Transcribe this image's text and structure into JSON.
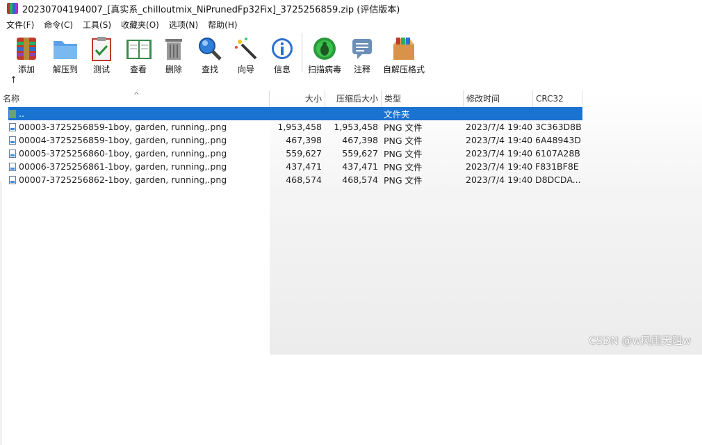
{
  "window": {
    "title": "20230704194007_[真实系_chilloutmix_NiPrunedFp32Fix]_3725256859.zip (评估版本)"
  },
  "menu": [
    "文件(F)",
    "命令(C)",
    "工具(S)",
    "收藏夹(O)",
    "选项(N)",
    "帮助(H)"
  ],
  "toolbar": {
    "add": "添加",
    "extract": "解压到",
    "test": "测试",
    "view": "查看",
    "delete": "删除",
    "find": "查找",
    "wizard": "向导",
    "info": "信息",
    "scan": "扫描病毒",
    "comment": "注释",
    "sfx": "自解压格式"
  },
  "nav": {
    "up": "↑"
  },
  "columns": {
    "name": "名称",
    "size": "大小",
    "packed": "压缩后大小",
    "type": "类型",
    "modified": "修改时间",
    "crc": "CRC32"
  },
  "parent_row": {
    "name": "..",
    "type": "文件夹"
  },
  "files": [
    {
      "name": "00003-3725256859-1boy, garden, running,.png",
      "size": "1,953,458",
      "packed": "1,953,458",
      "type": "PNG 文件",
      "modified": "2023/7/4 19:40",
      "crc": "3C363D8B"
    },
    {
      "name": "00004-3725256859-1boy, garden, running,.png",
      "size": "467,398",
      "packed": "467,398",
      "type": "PNG 文件",
      "modified": "2023/7/4 19:40",
      "crc": "6A48943D"
    },
    {
      "name": "00005-3725256860-1boy, garden, running,.png",
      "size": "559,627",
      "packed": "559,627",
      "type": "PNG 文件",
      "modified": "2023/7/4 19:40",
      "crc": "6107A28B"
    },
    {
      "name": "00006-3725256861-1boy, garden, running,.png",
      "size": "437,471",
      "packed": "437,471",
      "type": "PNG 文件",
      "modified": "2023/7/4 19:40",
      "crc": "F831BF8E"
    },
    {
      "name": "00007-3725256862-1boy, garden, running,.png",
      "size": "468,574",
      "packed": "468,574",
      "type": "PNG 文件",
      "modified": "2023/7/4 19:40",
      "crc": "D8DCDA..."
    }
  ],
  "watermark": "CSDN @w风雨无阻w",
  "colors": {
    "selection": "#1a73d1",
    "background": "#ffffff"
  }
}
